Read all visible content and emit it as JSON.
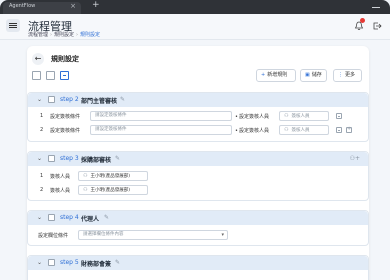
{
  "browser": {
    "tab_title": "AgentFlow",
    "tab_close": "×",
    "new_tab": "+"
  },
  "header": {
    "title": "流程管理",
    "breadcrumb": [
      "流程管理",
      "規則設定",
      "規則設定"
    ],
    "breadcrumb_sep": "›"
  },
  "page": {
    "title": "規則設定",
    "back_symbol": "←"
  },
  "toolbar": {
    "add_rule": "新增規則",
    "save": "儲存",
    "more": "更多",
    "add_icon": "+",
    "save_icon": "▣",
    "more_icon": "⋮"
  },
  "steps": [
    {
      "label": "step 2",
      "name": "部門主管審核",
      "rows": [
        {
          "num": "1",
          "condition_label": "設定簽核條件",
          "condition_placeholder": "請設定簽核條件",
          "approver_label": "設定簽核人員",
          "approver_placeholder": "簽核人員"
        },
        {
          "num": "2",
          "condition_label": "設定簽核條件",
          "condition_placeholder": "請設定簽核條件",
          "approver_label": "設定簽核人員",
          "approver_placeholder": "簽核人員"
        }
      ]
    },
    {
      "label": "step 3",
      "name": "採購部審核",
      "rows": [
        {
          "num": "1",
          "label": "簽核人員",
          "value": "王小明(產品發展部)"
        },
        {
          "num": "2",
          "label": "簽核人員",
          "value": "王小明(產品發展部)"
        }
      ]
    },
    {
      "label": "step 4",
      "name": "代理人",
      "field_label": "設定欄位條件",
      "field_placeholder": "請選擇欄位條件內容"
    },
    {
      "label": "step 5",
      "name": "財務部會簽"
    }
  ],
  "colors": {
    "accent": "#2f6fd6",
    "step_header_bg": "#e1ebf7",
    "badge": "#e53935"
  }
}
